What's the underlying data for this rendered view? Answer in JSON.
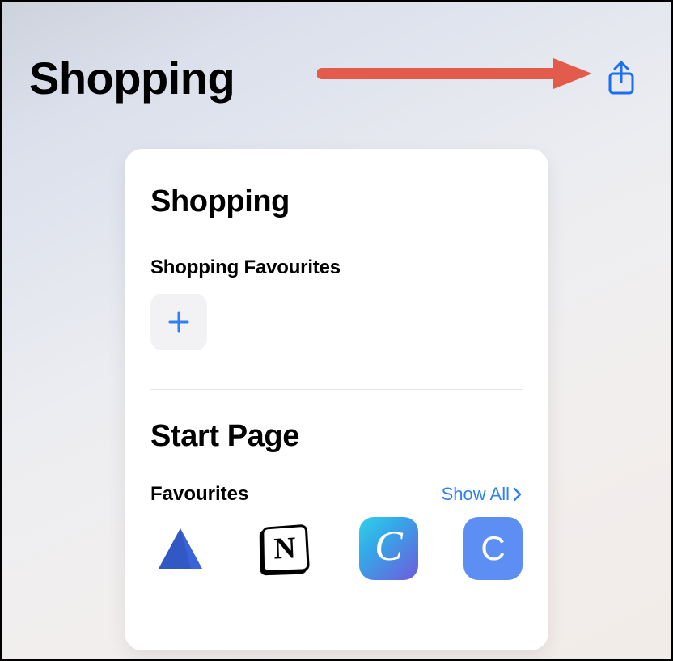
{
  "header": {
    "title": "Shopping",
    "share_label": "Share"
  },
  "card": {
    "title": "Shopping",
    "shopping_favourites_label": "Shopping Favourites",
    "add_label": "Add"
  },
  "startpage": {
    "title": "Start Page",
    "favourites_label": "Favourites",
    "show_all_label": "Show All",
    "icons": [
      {
        "name": "azure",
        "glyph": ""
      },
      {
        "name": "notion",
        "glyph": "N"
      },
      {
        "name": "canva",
        "glyph": "C"
      },
      {
        "name": "c-app",
        "glyph": "C"
      }
    ]
  },
  "colors": {
    "accent": "#1b6ff2",
    "arrow": "#e35b4a"
  }
}
